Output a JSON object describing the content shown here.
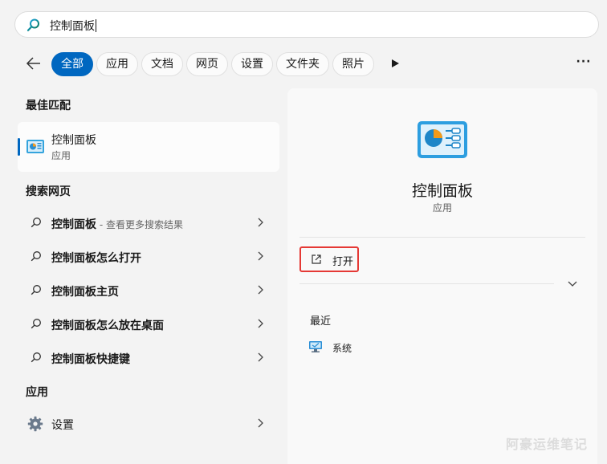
{
  "search": {
    "query": "控制面板"
  },
  "filters": {
    "back_icon": "back-arrow-icon",
    "tabs": [
      {
        "label": "全部",
        "active": true
      },
      {
        "label": "应用"
      },
      {
        "label": "文档"
      },
      {
        "label": "网页"
      },
      {
        "label": "设置"
      },
      {
        "label": "文件夹"
      },
      {
        "label": "照片"
      }
    ],
    "more_label": "···"
  },
  "left": {
    "best_match_heading": "最佳匹配",
    "best_match": {
      "title": "控制面板",
      "subtitle": "应用",
      "icon": "control-panel-icon"
    },
    "web_heading": "搜索网页",
    "web_results": [
      {
        "bold": "控制面板",
        "suffix": " - 查看更多搜索结果"
      },
      {
        "bold": "控制面板怎么打开",
        "suffix": ""
      },
      {
        "bold": "控制面板主页",
        "suffix": ""
      },
      {
        "bold": "控制面板怎么放在桌面",
        "suffix": ""
      },
      {
        "bold": "控制面板快捷键",
        "suffix": ""
      }
    ],
    "apps_heading": "应用",
    "app_results": [
      {
        "label": "设置",
        "icon": "gear-icon"
      }
    ]
  },
  "preview": {
    "title": "控制面板",
    "subtitle": "应用",
    "open_label": "打开",
    "recent_heading": "最近",
    "recent_items": [
      {
        "label": "系统",
        "icon": "system-monitor-icon"
      }
    ]
  },
  "watermark": "阿豪运维笔记",
  "colors": {
    "accent": "#0067c0",
    "highlight_border": "#e53935"
  }
}
